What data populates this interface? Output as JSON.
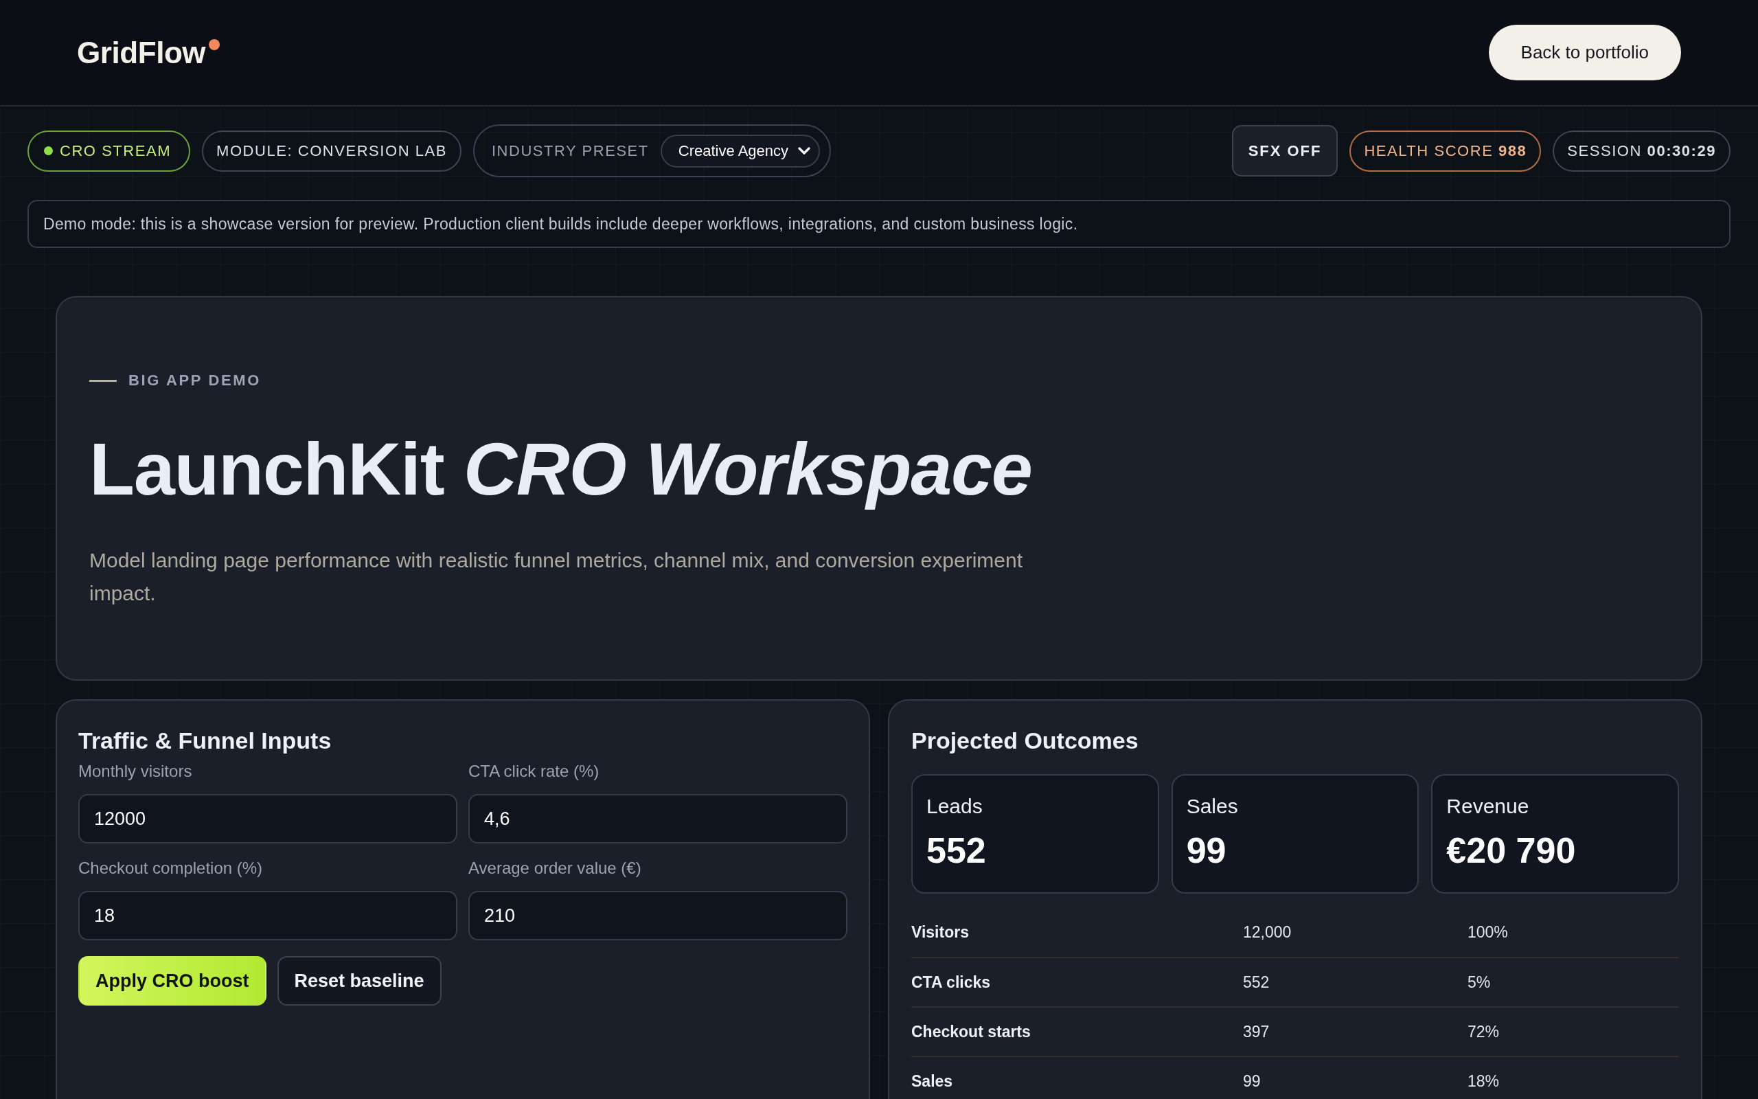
{
  "header": {
    "logo": "GridFlow",
    "back_button": "Back to portfolio"
  },
  "left_chips": [
    {
      "kind": "live",
      "label": "CRO STREAM"
    },
    {
      "kind": "neutral",
      "label": "MODULE: CONVERSION LAB"
    }
  ],
  "industry_preset": {
    "label": "INDUSTRY PRESET",
    "value": "Creative Agency"
  },
  "right_chips": [
    {
      "kind": "toggle",
      "label": "SFX OFF"
    },
    {
      "kind": "warning",
      "label": "HEALTH SCORE **988**"
    },
    {
      "kind": "neutral",
      "label": "SESSION **00:30:29**"
    }
  ],
  "demo_notice": "Demo mode: this is a showcase version for preview. Production client builds include deeper workflows, integrations, and custom business logic.",
  "hero": {
    "eyebrow": "BIG APP DEMO",
    "title": "LaunchKit *CRO Workspace*",
    "subtitle": "Model landing page performance with realistic funnel metrics, channel mix, and conversion experiment impact."
  },
  "inputs_panel": {
    "title": "Traffic & Funnel Inputs",
    "fields": [
      {
        "label": "Monthly visitors",
        "value": "12000"
      },
      {
        "label": "CTA click rate (%)",
        "value": "4,6"
      },
      {
        "label": "Checkout completion (%)",
        "value": "18"
      },
      {
        "label": "Average order value (€)",
        "value": "210"
      }
    ],
    "buttons": [
      {
        "kind": "primary",
        "label": "Apply CRO boost"
      },
      {
        "kind": "secondary",
        "label": "Reset baseline"
      }
    ]
  },
  "outcomes_panel": {
    "title": "Projected Outcomes",
    "stats": [
      {
        "label": "Leads",
        "value": "552"
      },
      {
        "label": "Sales",
        "value": "99"
      },
      {
        "label": "Revenue",
        "value": "€20 790"
      }
    ],
    "funnel_rows": [
      {
        "stage": "Visitors",
        "count": "12,000",
        "share": "100%"
      },
      {
        "stage": "CTA clicks",
        "count": "552",
        "share": "5%"
      },
      {
        "stage": "Checkout starts",
        "count": "397",
        "share": "72%"
      },
      {
        "stage": "Sales",
        "count": "99",
        "share": "18%"
      }
    ]
  }
}
